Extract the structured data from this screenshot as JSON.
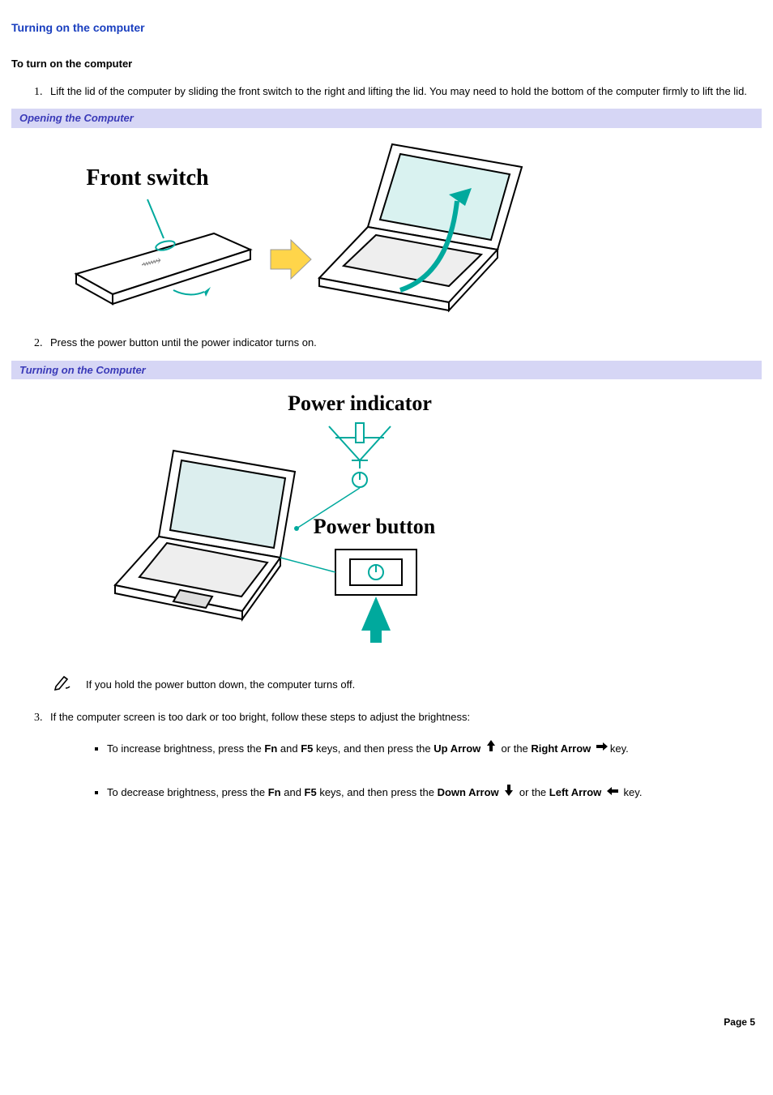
{
  "title": "Turning on the computer",
  "subhead": "To turn on the computer",
  "steps": {
    "s1": "Lift the lid of the computer by sliding the front switch to the right and lifting the lid. You may need to hold the bottom of the computer firmly to lift the lid.",
    "s2": "Press the power button until the power indicator turns on.",
    "s3": "If the computer screen is too dark or too bright, follow these steps to adjust the brightness:"
  },
  "captions": {
    "c1": "Opening the Computer",
    "c2": "Turning on the Computer"
  },
  "figure_labels": {
    "front_switch": "Front switch",
    "power_indicator": "Power indicator",
    "power_button": "Power button"
  },
  "note": "If you hold the power button down, the computer turns off.",
  "bullets": {
    "b1": {
      "p1": "To increase brightness, press the ",
      "fn": "Fn",
      "p2": " and ",
      "f5": "F5",
      "p3": " keys, and then press the ",
      "up": "Up Arrow",
      "p4": " or the ",
      "right": "Right Arrow",
      "p5": "key."
    },
    "b2": {
      "p1": "To decrease brightness, press the ",
      "fn": "Fn",
      "p2": " and ",
      "f5": "F5",
      "p3": " keys, and then press the ",
      "down": "Down Arrow",
      "p4": " or the ",
      "left": "Left Arrow",
      "p5": " key."
    }
  },
  "footer": "Page 5"
}
